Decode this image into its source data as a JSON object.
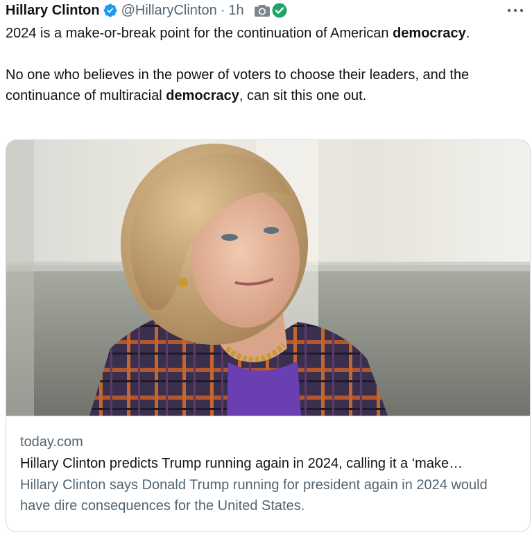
{
  "tweet": {
    "author_name": "Hillary Clinton",
    "handle": "@HillaryClinton",
    "separator": "·",
    "time": "1h",
    "more_label": "•••",
    "paragraph1_pre": "2024 is a make-or-break point for the continuation of American ",
    "paragraph1_bold": "democracy",
    "paragraph1_post": ".",
    "paragraph2_pre": "No one who believes in the power of voters to choose their leaders, and the continuance of multiracial ",
    "paragraph2_bold": "democracy",
    "paragraph2_post": ", can sit this one out."
  },
  "card": {
    "domain": "today.com",
    "title": "Hillary Clinton predicts Trump running again in 2024, calling it a ‘make…",
    "description": "Hillary Clinton says Donald Trump running for president again in 2024 would have dire consequences for the United States."
  },
  "icons": {
    "verified": "verified-badge-icon",
    "camera": "camera-icon",
    "check": "green-check-icon",
    "more": "more-options-icon"
  },
  "colors": {
    "verified_blue": "#1d9bf0",
    "check_green": "#21a366",
    "secondary_text": "#536471",
    "border": "#cfd9de"
  }
}
